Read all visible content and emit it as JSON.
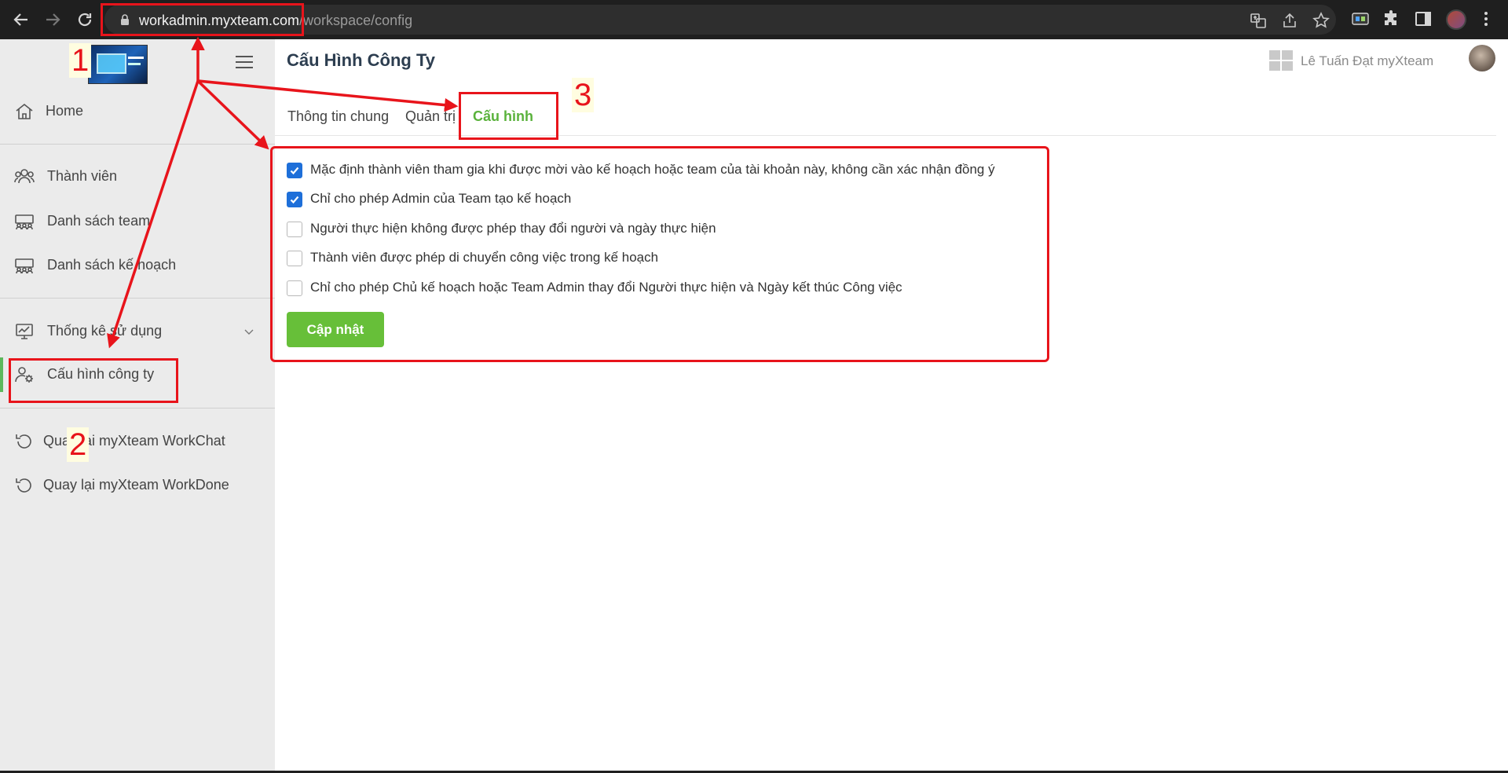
{
  "browser": {
    "url_host": "workadmin.myxteam.com",
    "url_path": "/workspace/config"
  },
  "sidebar": {
    "items": [
      {
        "label": "Home",
        "icon": "home-icon"
      },
      {
        "label": "Thành viên",
        "icon": "members-icon"
      },
      {
        "label": "Danh sách team",
        "icon": "team-list-icon"
      },
      {
        "label": "Danh sách kế hoạch",
        "icon": "plan-list-icon"
      },
      {
        "label": "Thống kê sử dụng",
        "icon": "statistics-icon"
      },
      {
        "label": "Cấu hình công ty",
        "icon": "company-config-icon",
        "active": true
      },
      {
        "label": "Quay lại myXteam WorkChat",
        "icon": "back-icon"
      },
      {
        "label": "Quay lại myXteam WorkDone",
        "icon": "back-icon"
      }
    ]
  },
  "header": {
    "title": "Cấu Hình Công Ty",
    "user_name": "Lê Tuấn Đạt myXteam"
  },
  "tabs": [
    {
      "label": "Thông tin chung"
    },
    {
      "label": "Quản trị"
    },
    {
      "label": "Cấu hình",
      "active": true
    }
  ],
  "settings": [
    {
      "label": "Mặc định thành viên tham gia khi được mời vào kế hoạch hoặc team của tài khoản này, không cần xác nhận đồng ý",
      "checked": true
    },
    {
      "label": "Chỉ cho phép Admin của Team tạo kế hoạch",
      "checked": true
    },
    {
      "label": "Người thực hiện không được phép thay đổi người và ngày thực hiện",
      "checked": false
    },
    {
      "label": "Thành viên được phép di chuyển công việc trong kế hoạch",
      "checked": false
    },
    {
      "label": "Chỉ cho phép Chủ kế hoạch hoặc Team Admin thay đổi Người thực hiện và Ngày kết thúc Công việc",
      "checked": false
    }
  ],
  "update_button": "Cập nhật",
  "annotations": {
    "num1": "1",
    "num2": "2",
    "num3": "3",
    "color": "#e8141b"
  },
  "colors": {
    "accent_green": "#5ab23c",
    "button_green": "#67bf39",
    "checkbox_blue": "#1e6fd9"
  }
}
